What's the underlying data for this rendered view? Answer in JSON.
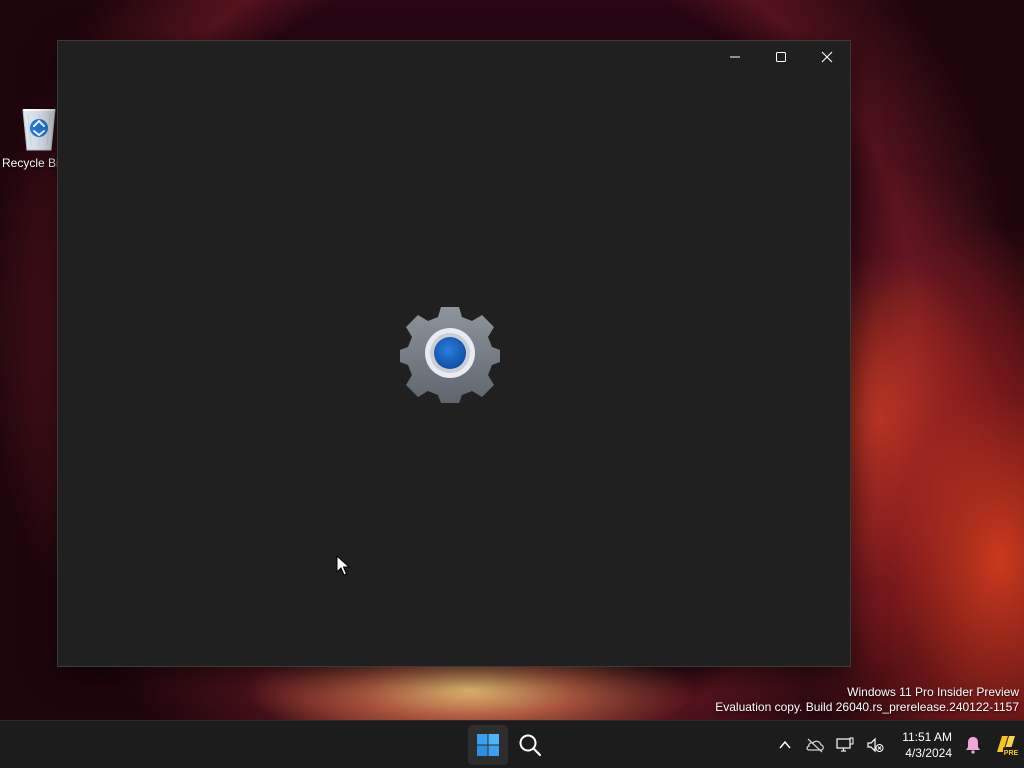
{
  "desktop": {
    "icons": [
      {
        "label": "Recycle Bin",
        "icon": "recycle-bin-icon"
      }
    ]
  },
  "window": {
    "content": "settings-gear-icon",
    "caption": {
      "minimize": "minimize-icon",
      "maximize": "maximize-icon",
      "close": "close-icon"
    }
  },
  "watermark": {
    "line1": "Windows 11 Pro Insider Preview",
    "line2": "Evaluation copy. Build 26040.rs_prerelease.240122-1157"
  },
  "taskbar": {
    "start_icon": "windows-start-icon",
    "search_icon": "search-icon",
    "tray": {
      "icons": [
        "chevron-up-icon",
        "onedrive-offline-icon",
        "network-icon",
        "volume-muted-icon"
      ],
      "time": "11:51 AM",
      "date": "4/3/2024",
      "notification_icon": "notification-bell-icon",
      "pre_icon": "copilot-pre-icon",
      "pre_badge": "PRE"
    }
  },
  "colors": {
    "window_bg": "#202020",
    "taskbar_bg": "#1c1c1c",
    "accent": "#1e6fd0",
    "start_blue": "#3aa0ef"
  }
}
